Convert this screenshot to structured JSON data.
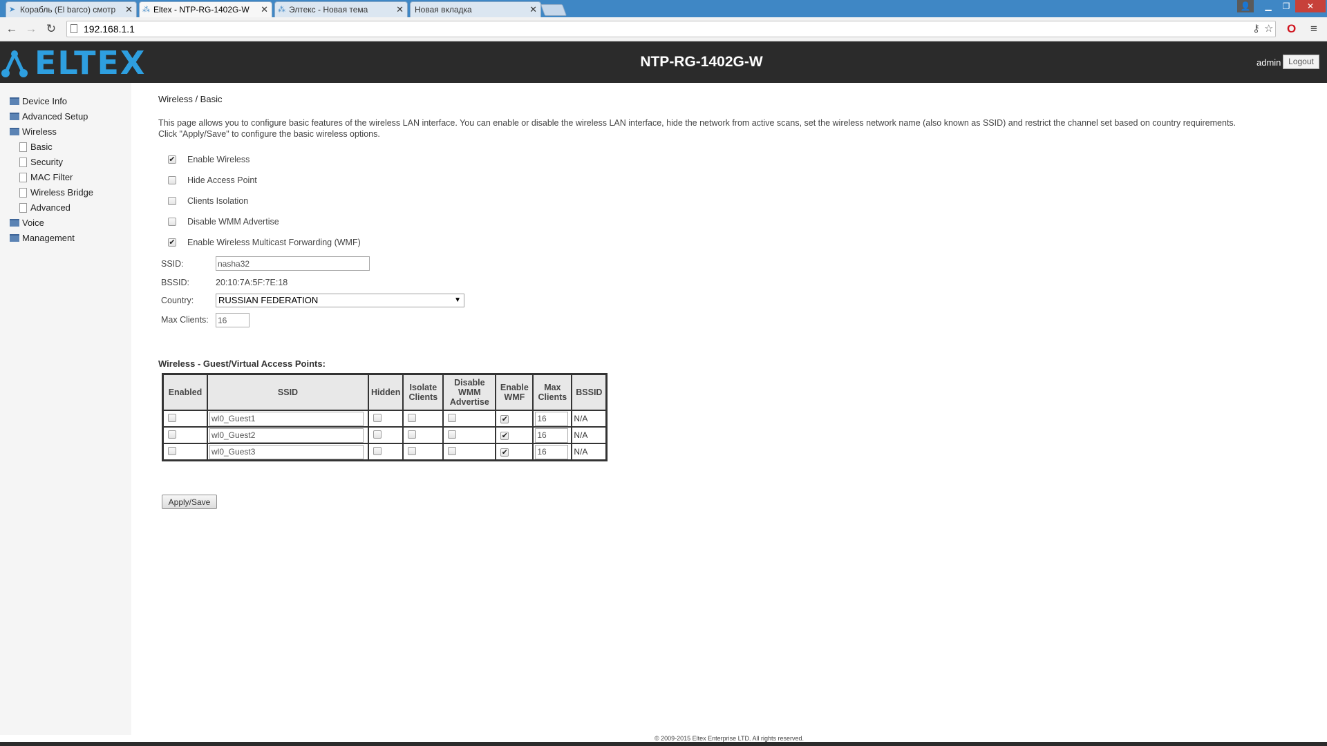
{
  "browser": {
    "tabs": [
      {
        "title": "Корабль (El barco) смотр"
      },
      {
        "title": "Eltex - NTP-RG-1402G-W"
      },
      {
        "title": "Элтекс - Новая тема"
      },
      {
        "title": "Новая вкладка"
      }
    ],
    "url": "192.168.1.1"
  },
  "header": {
    "logo_text": "ELTEX",
    "device_name": "NTP-RG-1402G-W",
    "user": "admin",
    "logout_label": "Logout"
  },
  "sidebar": {
    "items": [
      {
        "label": "Device Info",
        "type": "folder",
        "level": 0
      },
      {
        "label": "Advanced Setup",
        "type": "folder",
        "level": 0
      },
      {
        "label": "Wireless",
        "type": "folder",
        "level": 0
      },
      {
        "label": "Basic",
        "type": "doc",
        "level": 1
      },
      {
        "label": "Security",
        "type": "doc",
        "level": 1
      },
      {
        "label": "MAC Filter",
        "type": "doc",
        "level": 1
      },
      {
        "label": "Wireless Bridge",
        "type": "doc",
        "level": 1
      },
      {
        "label": "Advanced",
        "type": "doc",
        "level": 1
      },
      {
        "label": "Voice",
        "type": "folder",
        "level": 0
      },
      {
        "label": "Management",
        "type": "folder",
        "level": 0
      }
    ]
  },
  "main": {
    "title": "Wireless / Basic",
    "description": "This page allows you to configure basic features of the wireless LAN interface. You can enable or disable the wireless LAN interface, hide the network from active scans, set the wireless network name (also known as SSID) and restrict the channel set based on country requirements.\nClick \"Apply/Save\" to configure the basic wireless options.",
    "options": [
      {
        "label": "Enable Wireless",
        "checked": true
      },
      {
        "label": "Hide Access Point",
        "checked": false
      },
      {
        "label": "Clients Isolation",
        "checked": false
      },
      {
        "label": "Disable WMM Advertise",
        "checked": false
      },
      {
        "label": "Enable Wireless Multicast Forwarding (WMF)",
        "checked": true
      }
    ],
    "ssid_label": "SSID:",
    "ssid_value": "nasha32",
    "bssid_label": "BSSID:",
    "bssid_value": "20:10:7A:5F:7E:18",
    "country_label": "Country:",
    "country_value": "RUSSIAN FEDERATION",
    "max_clients_label": "Max Clients:",
    "max_clients_value": "16",
    "guest_title": "Wireless - Guest/Virtual Access Points:",
    "guest_headers": {
      "enabled": "Enabled",
      "ssid": "SSID",
      "hidden": "Hidden",
      "isolate_1": "Isolate",
      "isolate_2": "Clients",
      "wmm_1": "Disable",
      "wmm_2": "WMM",
      "wmm_3": "Advertise",
      "wmf_1": "Enable",
      "wmf_2": "WMF",
      "max_1": "Max",
      "max_2": "Clients",
      "bssid": "BSSID"
    },
    "guest_rows": [
      {
        "enabled": false,
        "ssid": "wl0_Guest1",
        "hidden": false,
        "isolate": false,
        "disable_wmm": false,
        "enable_wmf": true,
        "max_clients": "16",
        "bssid": "N/A"
      },
      {
        "enabled": false,
        "ssid": "wl0_Guest2",
        "hidden": false,
        "isolate": false,
        "disable_wmm": false,
        "enable_wmf": true,
        "max_clients": "16",
        "bssid": "N/A"
      },
      {
        "enabled": false,
        "ssid": "wl0_Guest3",
        "hidden": false,
        "isolate": false,
        "disable_wmm": false,
        "enable_wmf": true,
        "max_clients": "16",
        "bssid": "N/A"
      }
    ],
    "apply_label": "Apply/Save"
  },
  "footer": {
    "copyright": "© 2009-2015 Eltex Enterprise LTD. All rights reserved."
  },
  "colors": {
    "header_bg": "#2b2b2b",
    "brand_blue": "#2e9fe0",
    "tabbar_blue": "#3f87c5"
  }
}
